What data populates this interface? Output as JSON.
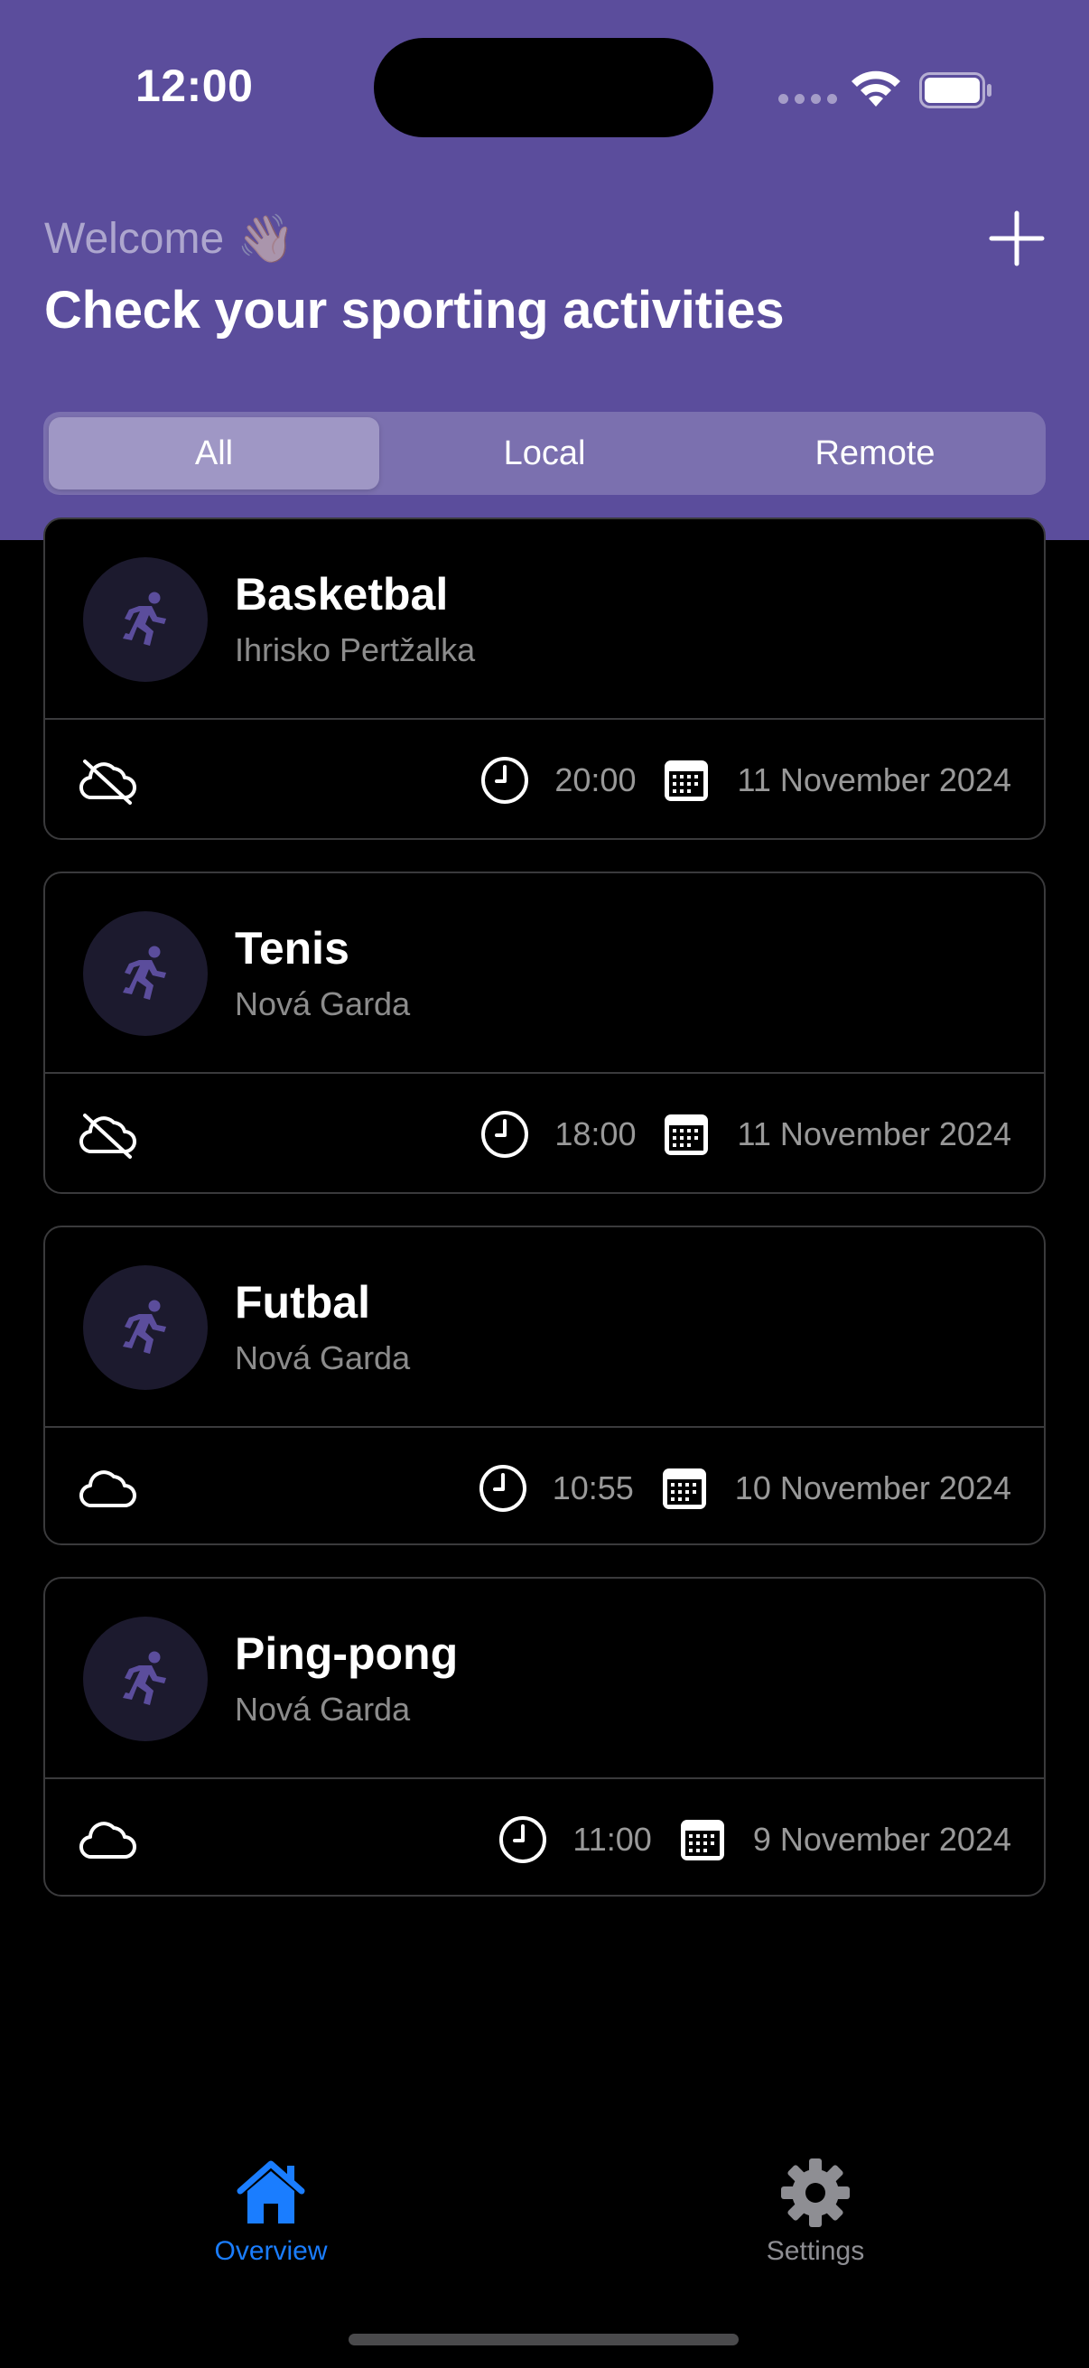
{
  "status_bar": {
    "time": "12:00"
  },
  "header": {
    "welcome": "Welcome",
    "wave_emoji": "👋🏻",
    "headline": "Check your sporting activities",
    "add_icon": "plus-icon"
  },
  "segments": [
    {
      "label": "All",
      "selected": true
    },
    {
      "label": "Local",
      "selected": false
    },
    {
      "label": "Remote",
      "selected": false
    }
  ],
  "activities": [
    {
      "title": "Basketbal",
      "location": "Ihrisko Pertžalka",
      "sync_icon": "cloud-slash-icon",
      "time": "20:00",
      "date": "11 November 2024"
    },
    {
      "title": "Tenis",
      "location": "Nová Garda",
      "sync_icon": "cloud-slash-icon",
      "time": "18:00",
      "date": "11 November 2024"
    },
    {
      "title": "Futbal",
      "location": "Nová Garda",
      "sync_icon": "cloud-icon",
      "time": "10:55",
      "date": "10 November 2024"
    },
    {
      "title": "Ping-pong",
      "location": "Nová Garda",
      "sync_icon": "cloud-icon",
      "time": "11:00",
      "date": "9 November 2024"
    }
  ],
  "tabbar": {
    "overview": {
      "label": "Overview",
      "icon": "house-icon",
      "selected": true
    },
    "settings": {
      "label": "Settings",
      "icon": "gear-icon",
      "selected": false
    }
  },
  "colors": {
    "header_bg": "#5b4d9c",
    "accent": "#1a7dff",
    "activity_icon": "#5b4d9c"
  }
}
